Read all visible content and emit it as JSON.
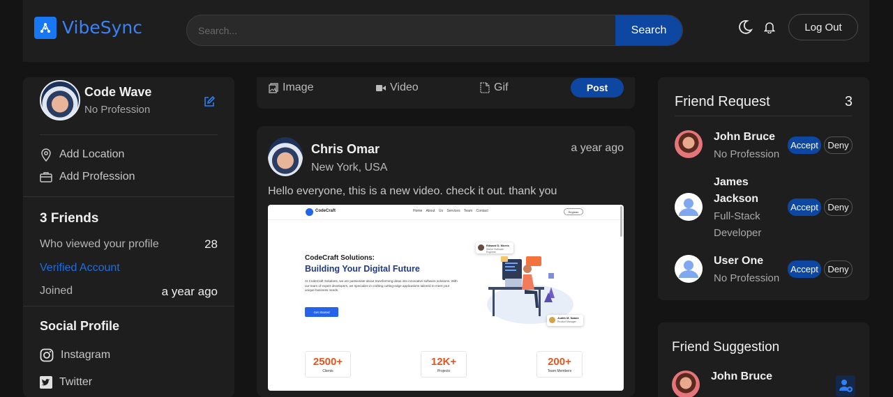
{
  "header": {
    "brand": "VibeSync",
    "search_placeholder": "Search...",
    "search_button": "Search",
    "logout": "Log Out"
  },
  "profile": {
    "name": "Code Wave",
    "profession": "No Profession",
    "add_location": "Add Location",
    "add_profession": "Add Profession",
    "friends_title": "3 Friends",
    "viewed_label": "Who viewed your profile",
    "viewed_value": "28",
    "verified": "Verified Account",
    "joined_label": "Joined",
    "joined_value": "a year ago",
    "social_title": "Social Profile",
    "social": [
      "Instagram",
      "Twitter"
    ]
  },
  "composer": {
    "image": "Image",
    "video": "Video",
    "gif": "Gif",
    "post": "Post"
  },
  "post": {
    "author": "Chris Omar",
    "location": "New York, USA",
    "time": "a year ago",
    "text": "Hello everyone, this is a new video. check it out. thank you",
    "media": {
      "brand": "CodeCraft",
      "nav": "Home About Us Services Team Contact",
      "register": "Register",
      "heading1": "CodeCraft Solutions:",
      "heading2": "Building Your Digital Future",
      "paragraph": "At CodeCraft Solutions, we are passionate about transforming ideas into innovative software solutions. With our team of expert developers, we specialize in crafting cutting-edge applications tailored to meet your unique business needs.",
      "cta": "Get Started",
      "badge1_name": "Edward D. Morris",
      "badge1_role": "Senior Software Engineer",
      "badge2_name": "Judith M. Natale",
      "badge2_role": "Product Manager",
      "stats": [
        {
          "value": "2500+",
          "label": "Clients"
        },
        {
          "value": "12K+",
          "label": "Projects"
        },
        {
          "value": "200+",
          "label": "Team Members"
        }
      ]
    }
  },
  "friend_requests": {
    "title": "Friend Request",
    "count": "3",
    "accept": "Accept",
    "deny": "Deny",
    "items": [
      {
        "name": "John Bruce",
        "sub": "No Profession"
      },
      {
        "name": "James Jackson",
        "sub": "Full-Stack Developer"
      },
      {
        "name": "User One",
        "sub": "No Profession"
      }
    ]
  },
  "friend_suggestion": {
    "title": "Friend Suggestion",
    "items": [
      {
        "name": "John Bruce"
      }
    ]
  }
}
